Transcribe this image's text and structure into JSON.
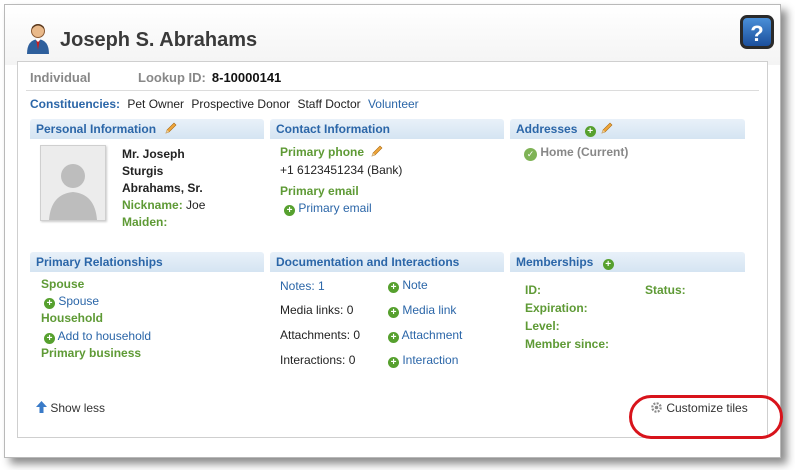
{
  "header": {
    "name": "Joseph S. Abrahams",
    "icons": {
      "person": "person-icon",
      "help": "help-icon"
    },
    "help_glyph": "?"
  },
  "record": {
    "type": "Individual",
    "lookup_label": "Lookup ID:",
    "lookup_value": "8-10000141",
    "constituencies_label": "Constituencies:",
    "constituencies": [
      "Pet Owner",
      "Prospective Donor",
      "Staff Doctor",
      "Volunteer"
    ]
  },
  "personal": {
    "title": "Personal Information",
    "name_lines": [
      "Mr. Joseph",
      "Sturgis",
      "Abrahams, Sr."
    ],
    "nickname_label": "Nickname:",
    "nickname": "Joe",
    "maiden_label": "Maiden:"
  },
  "contact": {
    "title": "Contact Information",
    "phone_label": "Primary phone",
    "phone": "+1 6123451234 (Bank)",
    "email_label": "Primary email",
    "email_add": "Primary email"
  },
  "addresses": {
    "title": "Addresses",
    "home": "Home (Current)"
  },
  "relationships": {
    "title": "Primary Relationships",
    "spouse_label": "Spouse",
    "spouse_add": "Spouse",
    "household_label": "Household",
    "household_add": "Add to household",
    "business_label": "Primary business"
  },
  "documentation": {
    "title": "Documentation and Interactions",
    "notes": "Notes: 1",
    "media": "Media links: 0",
    "attachments": "Attachments: 0",
    "interactions": "Interactions: 0",
    "add_note": "Note",
    "add_media": "Media link",
    "add_attachment": "Attachment",
    "add_interaction": "Interaction"
  },
  "memberships": {
    "title": "Memberships",
    "id": "ID:",
    "status": "Status:",
    "expiration": "Expiration:",
    "level": "Level:",
    "member_since": "Member since:"
  },
  "footer": {
    "show_less": "Show less",
    "customize": "Customize tiles"
  },
  "colors": {
    "link": "#2b66a8",
    "green": "#5e9a35",
    "highlight": "#d8131b",
    "tile_header": "#d5e4f2"
  }
}
